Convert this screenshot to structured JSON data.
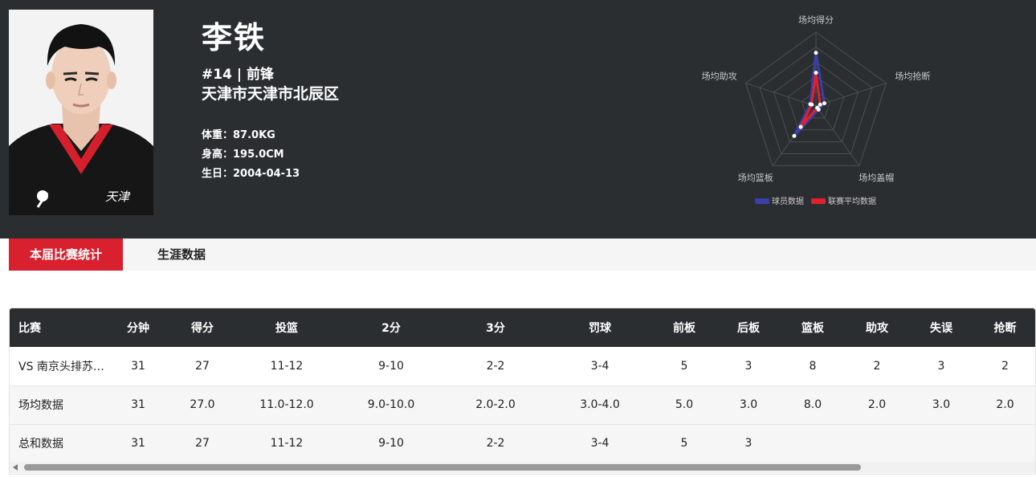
{
  "player": {
    "name": "李铁",
    "number_position": "#14 | 前锋",
    "hometown": "天津市天津市北辰区",
    "weight": "体重：87.0KG",
    "height": "身高：195.0CM",
    "birthday": "生日：2004-04-13",
    "jersey_text": "天津"
  },
  "radar": {
    "axes": [
      "场均得分",
      "场均抢断",
      "场均盖帽",
      "场均篮板",
      "场均助攻"
    ],
    "player_values": [
      0.72,
      0.12,
      0.06,
      0.5,
      0.08
    ],
    "league_values": [
      0.45,
      0.06,
      0.03,
      0.35,
      0.06
    ],
    "legend": [
      "球员数据",
      "联赛平均数据"
    ],
    "colors": {
      "player": "#3b3fa8",
      "league": "#e0202f"
    }
  },
  "tabs": [
    {
      "label": "本届比赛统计",
      "active": true
    },
    {
      "label": "生涯数据",
      "active": false
    }
  ],
  "table": {
    "headers": [
      "比赛",
      "分钟",
      "得分",
      "投篮",
      "2分",
      "3分",
      "罚球",
      "前板",
      "后板",
      "篮板",
      "助攻",
      "失误",
      "抢断"
    ],
    "rows": [
      [
        "VS 南京头排苏…",
        "31",
        "27",
        "11-12",
        "9-10",
        "2-2",
        "3-4",
        "5",
        "3",
        "8",
        "2",
        "3",
        "2"
      ],
      [
        "场均数据",
        "31",
        "27.0",
        "11.0-12.0",
        "9.0-10.0",
        "2.0-2.0",
        "3.0-4.0",
        "5.0",
        "3.0",
        "8.0",
        "2.0",
        "3.0",
        "2.0"
      ],
      [
        "总和数据",
        "31",
        "27",
        "11-12",
        "9-10",
        "2-2",
        "3-4",
        "5",
        "3",
        "",
        "",
        "",
        ""
      ]
    ]
  },
  "colors": {
    "header_bg": "#2b2e31",
    "accent": "#d9202f"
  }
}
